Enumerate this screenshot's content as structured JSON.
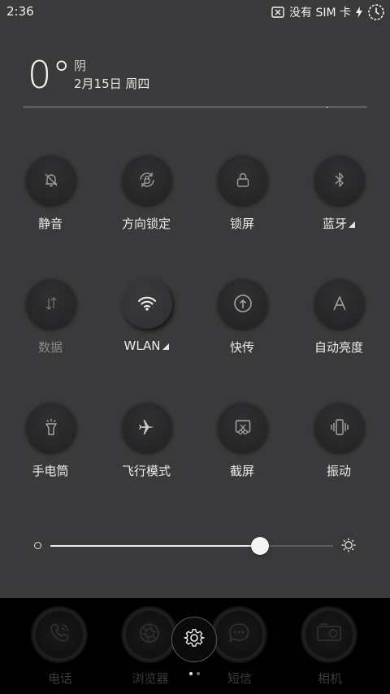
{
  "status_bar": {
    "time": "2:36",
    "sim_text": "没有 SIM 卡",
    "icons": [
      "no-sim-icon",
      "charging-bolt-icon",
      "clock-icon"
    ]
  },
  "weather": {
    "temperature": "0°",
    "condition": "阴",
    "date": "2月15日 周四"
  },
  "quick_settings": [
    {
      "label": "静音",
      "icon": "silent-bell-icon",
      "active": false,
      "dim": false,
      "expand": false
    },
    {
      "label": "方向锁定",
      "icon": "rotation-lock-icon",
      "active": false,
      "dim": false,
      "expand": false
    },
    {
      "label": "锁屏",
      "icon": "lock-icon",
      "active": false,
      "dim": false,
      "expand": false
    },
    {
      "label": "蓝牙",
      "icon": "bluetooth-icon",
      "active": false,
      "dim": false,
      "expand": true
    },
    {
      "label": "数据",
      "icon": "data-arrows-icon",
      "active": false,
      "dim": true,
      "expand": false
    },
    {
      "label": "WLAN",
      "icon": "wifi-icon",
      "active": true,
      "dim": false,
      "expand": true
    },
    {
      "label": "快传",
      "icon": "fast-transfer-icon",
      "active": false,
      "dim": false,
      "expand": false
    },
    {
      "label": "自动亮度",
      "icon": "auto-brightness-icon",
      "active": false,
      "dim": false,
      "expand": false
    },
    {
      "label": "手电筒",
      "icon": "flashlight-icon",
      "active": false,
      "dim": false,
      "expand": false
    },
    {
      "label": "飞行模式",
      "icon": "airplane-icon",
      "active": false,
      "dim": false,
      "expand": false
    },
    {
      "label": "截屏",
      "icon": "screenshot-icon",
      "active": false,
      "dim": false,
      "expand": false
    },
    {
      "label": "振动",
      "icon": "vibrate-icon",
      "active": false,
      "dim": false,
      "expand": false
    }
  ],
  "brightness": {
    "level": 0.74
  },
  "dock": {
    "apps": [
      {
        "label": "电话",
        "icon": "phone-icon"
      },
      {
        "label": "浏览器",
        "icon": "browser-icon"
      },
      {
        "label": "短信",
        "icon": "messages-icon"
      },
      {
        "label": "相机",
        "icon": "camera-icon"
      }
    ],
    "settings_icon": "gear-icon",
    "page_count": 2,
    "current_page": 1
  },
  "colors": {
    "panel_bg": "#3a3a3c",
    "button_bg": "#262628",
    "accent": "#f4f4f4",
    "dock_bg": "#000000"
  }
}
